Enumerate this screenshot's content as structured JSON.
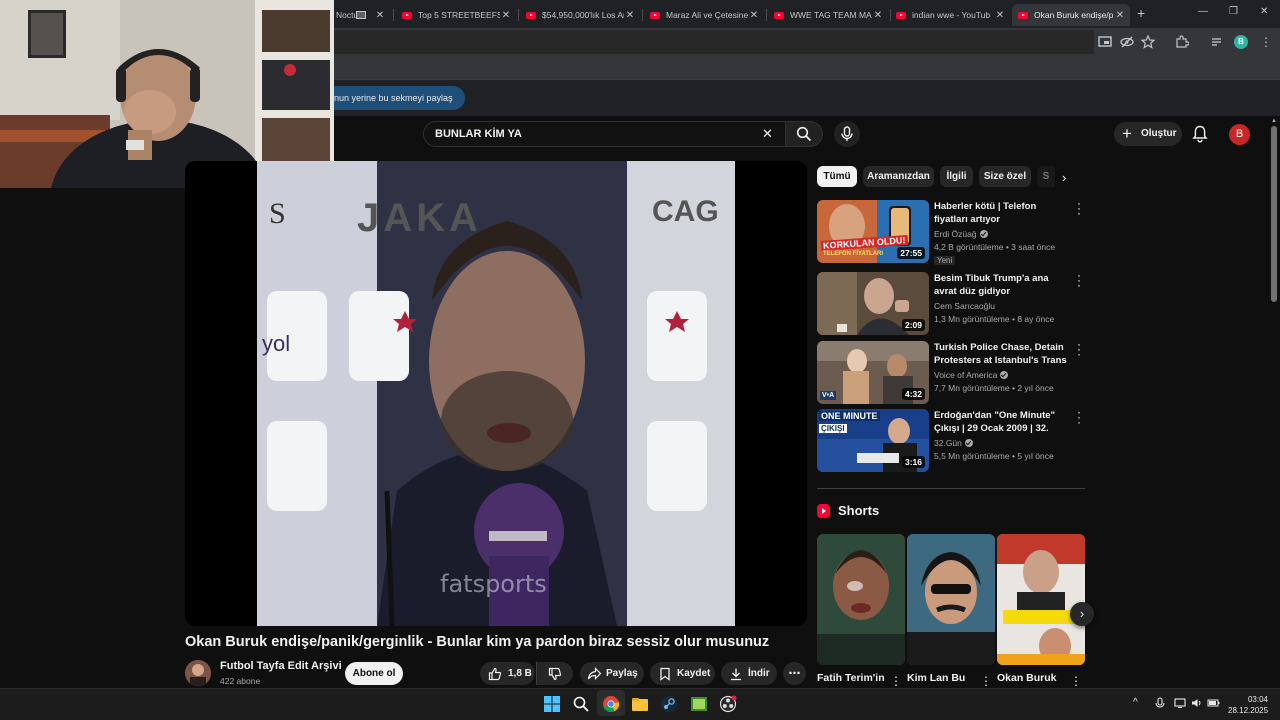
{
  "browser": {
    "tabs": [
      {
        "title": "Noctu",
        "active": false
      },
      {
        "title": "Top 5 STREETBEEFS K",
        "active": false
      },
      {
        "title": "$54,950,000'lık Los Ar",
        "active": false
      },
      {
        "title": "Maraz Ali ve Çetesine",
        "active": false
      },
      {
        "title": "WWE TAG TEAM MA",
        "active": false
      },
      {
        "title": "indian wwe - YouTub",
        "active": false
      },
      {
        "title": "Okan Buruk endişe/p",
        "active": true
      }
    ],
    "profile_initial": "B",
    "share_banner": "nun yerine bu sekmeyi paylaş"
  },
  "masthead": {
    "search_query": "BUNLAR KİM YA",
    "create_label": "Oluştur",
    "avatar_initial": "B"
  },
  "player": {
    "watermark": "fatsports"
  },
  "video": {
    "title": "Okan Buruk endişe/panik/gerginlik - Bunlar kim ya pardon biraz sessiz olur musunuz",
    "channel": "Futbol Tayfa Edit Arşivi",
    "subscribers": "422 abone",
    "subscribe_label": "Abone ol",
    "likes": "1,8 B",
    "share_label": "Paylaş",
    "save_label": "Kaydet",
    "download_label": "İndir"
  },
  "chips": [
    "Tümü",
    "Aramanızdan",
    "İlgili",
    "Size özel",
    "S"
  ],
  "recommendations": [
    {
      "title": "Haberler kötü | Telefon fiyatları artıyor",
      "channel": "Erdi Özüağ",
      "verified": true,
      "views": "4,2 B görüntüleme",
      "age": "3 saat önce",
      "badge": "Yeni",
      "duration": "27:55",
      "thumb_text": "KORKULAN OLDU!",
      "thumb_sub": "TELEFON FİYATLARI"
    },
    {
      "title": "Besim Tibuk Trump'a ana avrat düz gidiyor",
      "channel": "Cem Sarıcaoğlu",
      "verified": false,
      "views": "1,3 Mn görüntüleme",
      "age": "8 ay önce",
      "badge": "",
      "duration": "2:09"
    },
    {
      "title": "Turkish Police Chase, Detain Protesters at Istanbul's Trans ...",
      "channel": "Voice of America",
      "verified": true,
      "views": "7,7 Mn görüntüleme",
      "age": "2 yıl önce",
      "badge": "",
      "duration": "4:32",
      "thumb_text": "V•A"
    },
    {
      "title": "Erdoğan'dan \"One Minute\" Çıkışı | 29 Ocak 2009 | 32. Gün Arşivi",
      "channel": "32.Gün",
      "verified": true,
      "views": "5,5 Mn görüntüleme",
      "age": "5 yıl önce",
      "badge": "",
      "duration": "3:16",
      "thumb_text": "ONE MINUTE",
      "thumb_sub": "ÇIKIŞI"
    }
  ],
  "shorts": {
    "heading": "Shorts",
    "items": [
      {
        "title": "Fatih Terim'in"
      },
      {
        "title": "Kim Lan Bu"
      },
      {
        "title": "Okan Buruk"
      }
    ]
  },
  "taskbar": {
    "time": "03:04",
    "date": "28.12.2025"
  },
  "colors": {
    "youtube_red": "#ff0033",
    "background": "#0f0f0f",
    "chip_bg": "#272727",
    "avatar": "#c62828"
  }
}
